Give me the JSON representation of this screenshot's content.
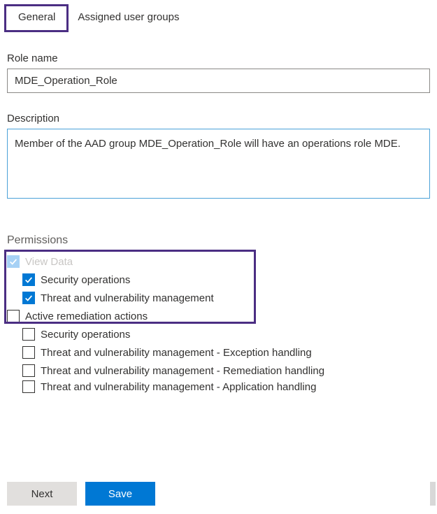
{
  "tabs": {
    "general": "General",
    "assigned": "Assigned user groups"
  },
  "role_name": {
    "label": "Role name",
    "value": "MDE_Operation_Role"
  },
  "description": {
    "label": "Description",
    "value": "Member of the AAD group MDE_Operation_Role will have an operations role MDE."
  },
  "permissions": {
    "label": "Permissions",
    "items": [
      {
        "label": "View Data",
        "checked": true,
        "disabled": true,
        "indent": 0
      },
      {
        "label": "Security operations",
        "checked": true,
        "disabled": false,
        "indent": 1
      },
      {
        "label": "Threat and vulnerability management",
        "checked": true,
        "disabled": false,
        "indent": 1
      },
      {
        "label": "Active remediation actions",
        "checked": false,
        "disabled": false,
        "indent": 0
      },
      {
        "label": "Security operations",
        "checked": false,
        "disabled": false,
        "indent": 1
      },
      {
        "label": "Threat and vulnerability management - Exception handling",
        "checked": false,
        "disabled": false,
        "indent": 1
      },
      {
        "label": "Threat and vulnerability management - Remediation handling",
        "checked": false,
        "disabled": false,
        "indent": 1
      },
      {
        "label": "Threat and vulnerability management - Application handling",
        "checked": false,
        "disabled": false,
        "indent": 1
      }
    ]
  },
  "footer": {
    "next": "Next",
    "save": "Save"
  }
}
